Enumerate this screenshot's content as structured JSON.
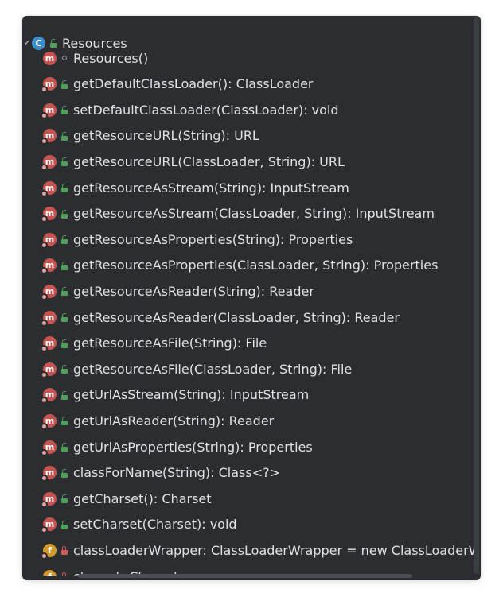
{
  "class_node": {
    "label": "Resources",
    "icon": "class-icon",
    "visibility": "public",
    "expanded": true
  },
  "members": [
    {
      "label": "Resources()",
      "kind": "method",
      "visibility": "package",
      "static": false
    },
    {
      "label": "getDefaultClassLoader(): ClassLoader",
      "kind": "method",
      "visibility": "public",
      "static": true
    },
    {
      "label": "setDefaultClassLoader(ClassLoader): void",
      "kind": "method",
      "visibility": "public",
      "static": true
    },
    {
      "label": "getResourceURL(String): URL",
      "kind": "method",
      "visibility": "public",
      "static": true
    },
    {
      "label": "getResourceURL(ClassLoader, String): URL",
      "kind": "method",
      "visibility": "public",
      "static": true
    },
    {
      "label": "getResourceAsStream(String): InputStream",
      "kind": "method",
      "visibility": "public",
      "static": true
    },
    {
      "label": "getResourceAsStream(ClassLoader, String): InputStream",
      "kind": "method",
      "visibility": "public",
      "static": true
    },
    {
      "label": "getResourceAsProperties(String): Properties",
      "kind": "method",
      "visibility": "public",
      "static": true
    },
    {
      "label": "getResourceAsProperties(ClassLoader, String): Properties",
      "kind": "method",
      "visibility": "public",
      "static": true
    },
    {
      "label": "getResourceAsReader(String): Reader",
      "kind": "method",
      "visibility": "public",
      "static": true
    },
    {
      "label": "getResourceAsReader(ClassLoader, String): Reader",
      "kind": "method",
      "visibility": "public",
      "static": true
    },
    {
      "label": "getResourceAsFile(String): File",
      "kind": "method",
      "visibility": "public",
      "static": true
    },
    {
      "label": "getResourceAsFile(ClassLoader, String): File",
      "kind": "method",
      "visibility": "public",
      "static": true
    },
    {
      "label": "getUrlAsStream(String): InputStream",
      "kind": "method",
      "visibility": "public",
      "static": true
    },
    {
      "label": "getUrlAsReader(String): Reader",
      "kind": "method",
      "visibility": "public",
      "static": true
    },
    {
      "label": "getUrlAsProperties(String): Properties",
      "kind": "method",
      "visibility": "public",
      "static": true
    },
    {
      "label": "classForName(String): Class<?>",
      "kind": "method",
      "visibility": "public",
      "static": true
    },
    {
      "label": "getCharset(): Charset",
      "kind": "method",
      "visibility": "public",
      "static": true
    },
    {
      "label": "setCharset(Charset): void",
      "kind": "method",
      "visibility": "public",
      "static": true
    },
    {
      "label": "classLoaderWrapper: ClassLoaderWrapper = new ClassLoaderWr",
      "kind": "field",
      "visibility": "private",
      "static": true
    },
    {
      "label": "charset: Charset",
      "kind": "field",
      "visibility": "private",
      "static": true
    }
  ],
  "colors": {
    "background": "#2b2d30",
    "text": "#dfe1e5",
    "class_icon": "#3d8fc9",
    "method_icon": "#c75450",
    "field_icon": "#d19a2a",
    "public_marker": "#4ea05b",
    "private_marker": "#d35b56"
  }
}
